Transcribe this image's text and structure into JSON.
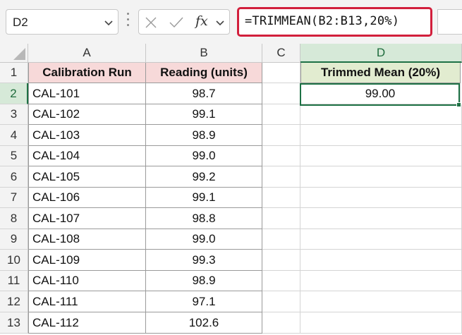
{
  "formula_bar": {
    "name_box": "D2",
    "formula": "=TRIMMEAN(B2:B13,20%)",
    "fx_label": "fx"
  },
  "columns": [
    "A",
    "B",
    "C",
    "D"
  ],
  "selected_column": "D",
  "selected_row": "2",
  "headers": {
    "a": "Calibration Run",
    "b": "Reading (units)",
    "d": "Trimmed Mean (20%)"
  },
  "result": "99.00",
  "rows": [
    {
      "n": "1"
    },
    {
      "n": "2",
      "run": "CAL-101",
      "reading": "98.7"
    },
    {
      "n": "3",
      "run": "CAL-102",
      "reading": "99.1"
    },
    {
      "n": "4",
      "run": "CAL-103",
      "reading": "98.9"
    },
    {
      "n": "5",
      "run": "CAL-104",
      "reading": "99.0"
    },
    {
      "n": "6",
      "run": "CAL-105",
      "reading": "99.2"
    },
    {
      "n": "7",
      "run": "CAL-106",
      "reading": "99.1"
    },
    {
      "n": "8",
      "run": "CAL-107",
      "reading": "98.8"
    },
    {
      "n": "9",
      "run": "CAL-108",
      "reading": "99.0"
    },
    {
      "n": "10",
      "run": "CAL-109",
      "reading": "99.3"
    },
    {
      "n": "11",
      "run": "CAL-110",
      "reading": "98.9"
    },
    {
      "n": "12",
      "run": "CAL-111",
      "reading": "97.1"
    },
    {
      "n": "13",
      "run": "CAL-112",
      "reading": "102.6"
    }
  ],
  "colors": {
    "accent": "#1e7145",
    "highlight_border": "#d21f3c",
    "header_a_fill": "#f7d9d9",
    "header_d_fill": "#e2ecd0"
  }
}
